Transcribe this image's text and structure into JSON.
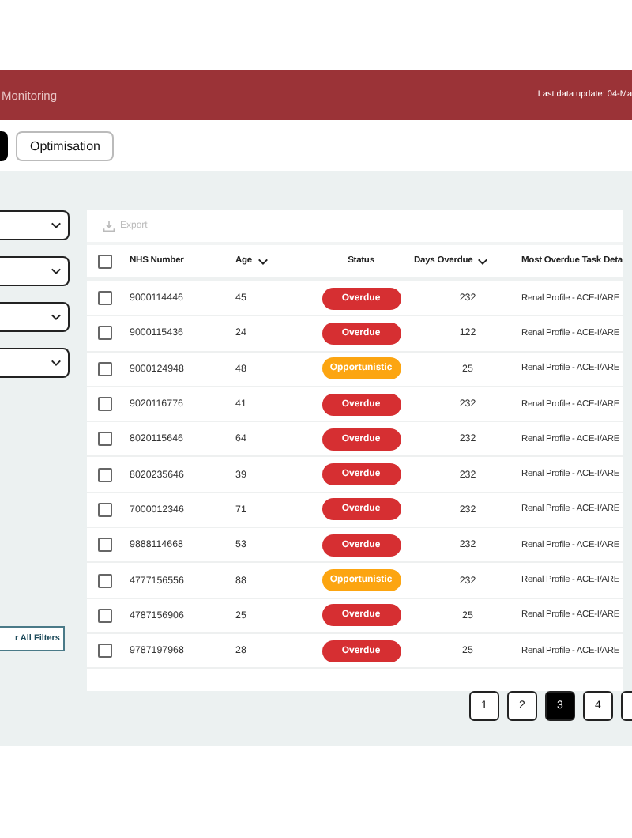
{
  "header": {
    "title": "Monitoring",
    "last_update": "Last data update: 04-Ma"
  },
  "tabs": [
    {
      "selected": true
    },
    {
      "label": "Optimisation",
      "selected": false
    }
  ],
  "filters": {
    "clear_button": "r All Filters"
  },
  "table": {
    "export": "Export",
    "all_checked": false,
    "columns": [
      {
        "label": "NHS Number",
        "sortable": false
      },
      {
        "label": "Age",
        "sortable": true
      },
      {
        "label": "Status",
        "sortable": false
      },
      {
        "label": "Days Overdue",
        "sortable": true
      },
      {
        "label": "Most Overdue Task Deta",
        "sortable": false
      }
    ],
    "rows": [
      {
        "checked": false,
        "nhs": "9000114446",
        "age": "45",
        "status": "Overdue",
        "kind": "overdue",
        "days": "232",
        "task": "Renal Profile - ACE-I/ARE"
      },
      {
        "checked": false,
        "nhs": "9000115436",
        "age": "24",
        "status": "Overdue",
        "kind": "overdue",
        "days": "122",
        "task": "Renal Profile - ACE-I/ARE"
      },
      {
        "checked": false,
        "nhs": "9000124948",
        "age": "48",
        "status": "Opportunistic",
        "kind": "opportunistic",
        "days": "25",
        "task": "Renal Profile - ACE-I/ARE"
      },
      {
        "checked": false,
        "nhs": "9020116776",
        "age": "41",
        "status": "Overdue",
        "kind": "overdue",
        "days": "232",
        "task": "Renal Profile - ACE-I/ARE"
      },
      {
        "checked": false,
        "nhs": "8020115646",
        "age": "64",
        "status": "Overdue",
        "kind": "overdue",
        "days": "232",
        "task": "Renal Profile - ACE-I/ARE"
      },
      {
        "checked": false,
        "nhs": "8020235646",
        "age": "39",
        "status": "Overdue",
        "kind": "overdue",
        "days": "232",
        "task": "Renal Profile - ACE-I/ARE"
      },
      {
        "checked": false,
        "nhs": "7000012346",
        "age": "71",
        "status": "Overdue",
        "kind": "overdue",
        "days": "232",
        "task": "Renal Profile - ACE-I/ARE"
      },
      {
        "checked": false,
        "nhs": "9888114668",
        "age": "53",
        "status": "Overdue",
        "kind": "overdue",
        "days": "232",
        "task": "Renal Profile - ACE-I/ARE"
      },
      {
        "checked": false,
        "nhs": "4777156556",
        "age": "88",
        "status": "Opportunistic",
        "kind": "opportunistic",
        "days": "232",
        "task": "Renal Profile - ACE-I/ARE"
      },
      {
        "checked": false,
        "nhs": "4787156906",
        "age": "25",
        "status": "Overdue",
        "kind": "overdue",
        "days": "25",
        "task": "Renal Profile - ACE-I/ARE"
      },
      {
        "checked": false,
        "nhs": "9787197968",
        "age": "28",
        "status": "Overdue",
        "kind": "overdue",
        "days": "25",
        "task": "Renal Profile - ACE-I/ARE"
      }
    ]
  },
  "pagination": [
    {
      "label": "1",
      "selected": false
    },
    {
      "label": "2",
      "selected": false
    },
    {
      "label": "3",
      "selected": true
    },
    {
      "label": "4",
      "selected": false
    },
    {
      "selected": false
    }
  ]
}
